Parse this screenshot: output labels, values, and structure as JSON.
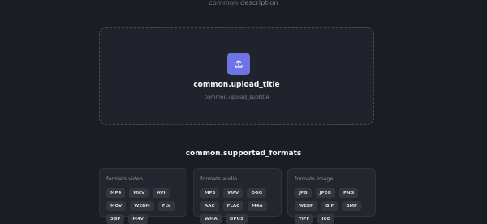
{
  "description": "common.description",
  "upload": {
    "title": "common.upload_title",
    "subtitle": "common.upload_subtitle",
    "icon": "upload-icon",
    "accent": "#6f74e4"
  },
  "formats": {
    "title": "common.supported_formats",
    "groups": [
      {
        "label": "formats.video",
        "items": [
          "MP4",
          "MKV",
          "AVI",
          "MOV",
          "WEBM",
          "FLV",
          "3GP",
          "M4V"
        ]
      },
      {
        "label": "formats.audio",
        "items": [
          "MP3",
          "WAV",
          "OGG",
          "AAC",
          "FLAC",
          "M4A",
          "WMA",
          "OPUS"
        ]
      },
      {
        "label": "formats.image",
        "items": [
          "JPG",
          "JPEG",
          "PNG",
          "WEBP",
          "GIF",
          "BMP",
          "TIFF",
          "ICO"
        ]
      }
    ]
  }
}
